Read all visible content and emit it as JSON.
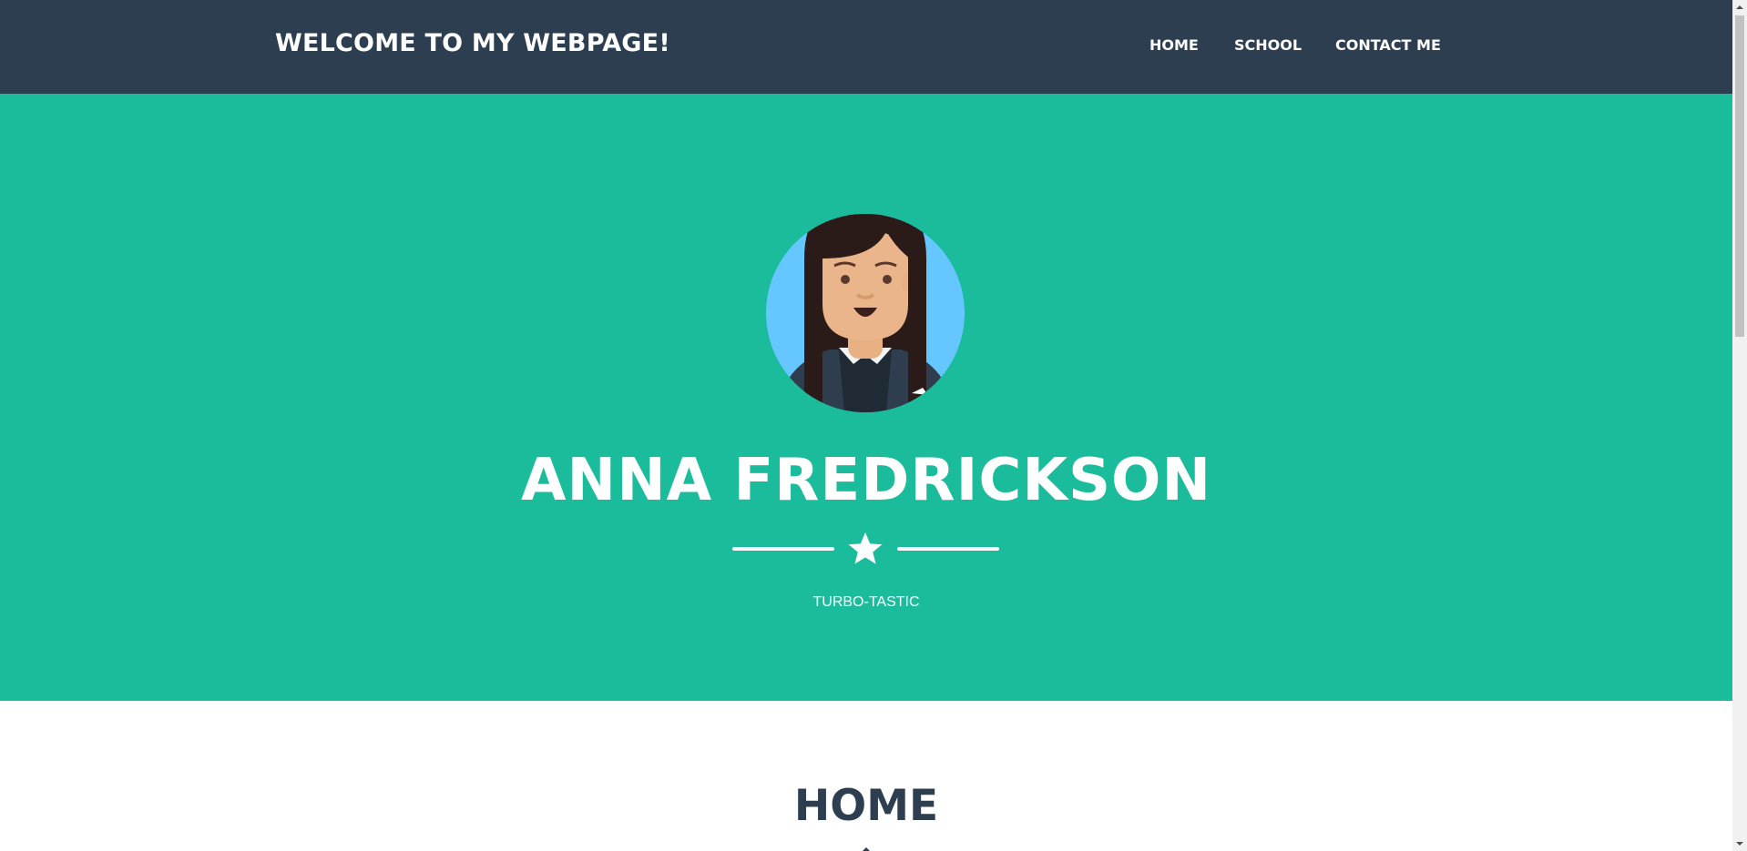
{
  "navbar": {
    "brand": "WELCOME TO MY WEBPAGE!",
    "links": [
      {
        "label": "HOME"
      },
      {
        "label": "SCHOOL"
      },
      {
        "label": "CONTACT ME"
      }
    ]
  },
  "masthead": {
    "avatar_icon": "avatar-woman-icon",
    "name": "ANNA FREDRICKSON",
    "divider_icon": "star-icon",
    "subtitle": "TURBO-TASTIC"
  },
  "home_section": {
    "heading": "HOME"
  },
  "colors": {
    "navbar": "#2c3e50",
    "masthead": "#1abc9c",
    "heading_text": "#2c3e50",
    "avatar_background": "#66c6ff"
  }
}
